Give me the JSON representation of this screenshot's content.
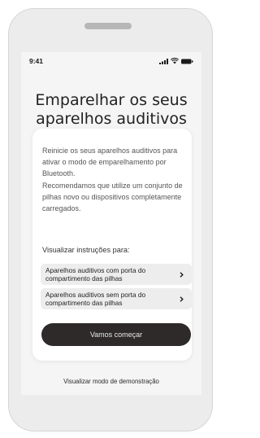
{
  "status_bar": {
    "time": "9:41"
  },
  "title": {
    "line1": "Emparelhar os seus",
    "line2": "aparelhos auditivos"
  },
  "card": {
    "paragraph1": "Reinicie os seus aparelhos auditivos para ativar o modo de emparelhamento por Bluetooth.",
    "paragraph2": "Recomendamos que utilize um conjunto de pilhas novo ou dispositivos completamente carregados.",
    "instructions_label": "Visualizar instruções para:",
    "options": [
      {
        "label": "Aparelhos auditivos com porta do compartimento das pilhas"
      },
      {
        "label": "Aparelhos auditivos sem porta do compartimento das pilhas"
      }
    ],
    "start_button": "Vamos começar"
  },
  "demo_link": "Visualizar modo de demonstração",
  "colors": {
    "primary_button": "#2e2a2a",
    "screen_background": "#f5f5f5"
  },
  "icons": [
    "signal-icon",
    "wifi-icon",
    "battery-icon",
    "chevron-right-icon"
  ]
}
